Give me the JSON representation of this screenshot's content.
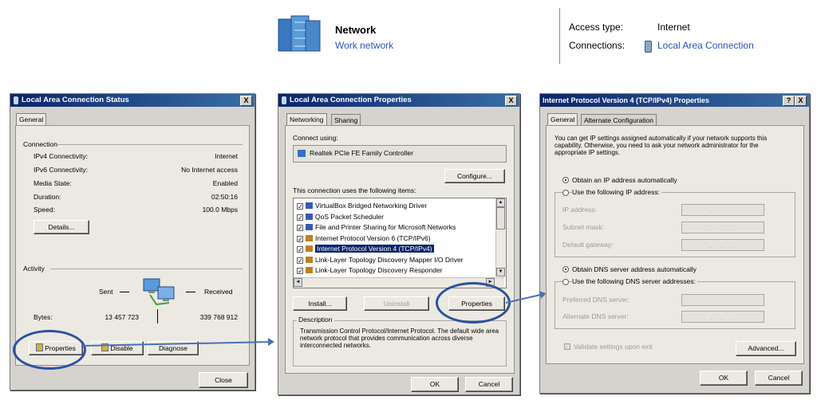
{
  "network_header": {
    "name": "Network",
    "type": "Work network",
    "access_label": "Access type:",
    "access_value": "Internet",
    "connections_label": "Connections:",
    "connections_value": "Local Area Connection"
  },
  "status_window": {
    "title": "Local Area Connection Status",
    "close_glyph": "X",
    "tab": "General",
    "connection_heading": "Connection",
    "rows": [
      {
        "label": "IPv4 Connectivity:",
        "value": "Internet"
      },
      {
        "label": "IPv6 Connectivity:",
        "value": "No Internet access"
      },
      {
        "label": "Media State:",
        "value": "Enabled"
      },
      {
        "label": "Duration:",
        "value": "02:50:16"
      },
      {
        "label": "Speed:",
        "value": "100.0 Mbps"
      }
    ],
    "details_button": "Details...",
    "activity_heading": "Activity",
    "sent_label": "Sent",
    "received_label": "Received",
    "bytes_label": "Bytes:",
    "bytes_sent": "13 457 723",
    "bytes_received": "339 768 912",
    "properties_button": "Properties",
    "disable_button": "Disable",
    "diagnose_button": "Diagnose",
    "close_button": "Close"
  },
  "properties_window": {
    "title": "Local Area Connection Properties",
    "close_glyph": "X",
    "tabs": [
      "Networking",
      "Sharing"
    ],
    "connect_using_label": "Connect using:",
    "adapter": "Realtek PCIe FE Family Controller",
    "configure_button": "Configure...",
    "items_label": "This connection uses the following items:",
    "items": [
      {
        "label": "VirtualBox Bridged Networking Driver",
        "checked": true,
        "icon_color": "#3a5ab0"
      },
      {
        "label": "QoS Packet Scheduler",
        "checked": true,
        "icon_color": "#3a5ab0"
      },
      {
        "label": "File and Printer Sharing for Microsoft Networks",
        "checked": true,
        "icon_color": "#3a5ab0"
      },
      {
        "label": "Internet Protocol Version 6 (TCP/IPv6)",
        "checked": true,
        "icon_color": "#c08020"
      },
      {
        "label": "Internet Protocol Version 4 (TCP/IPv4)",
        "checked": true,
        "icon_color": "#c08020",
        "selected": true
      },
      {
        "label": "Link-Layer Topology Discovery Mapper I/O Driver",
        "checked": true,
        "icon_color": "#c08020"
      },
      {
        "label": "Link-Layer Topology Discovery Responder",
        "checked": true,
        "icon_color": "#c08020"
      }
    ],
    "install_button": "Install...",
    "uninstall_button": "Uninstall",
    "properties_button": "Properties",
    "description_heading": "Description",
    "description_text": "Transmission Control Protocol/Internet Protocol. The default wide area network protocol that provides communication across diverse interconnected networks.",
    "ok_button": "OK",
    "cancel_button": "Cancel"
  },
  "ipv4_window": {
    "title": "Internet Protocol Version 4 (TCP/IPv4) Properties",
    "help_glyph": "?",
    "close_glyph": "X",
    "tabs": [
      "General",
      "Alternate Configuration"
    ],
    "intro": "You can get IP settings assigned automatically if your network supports this capability. Otherwise, you need to ask your network administrator for the appropriate IP settings.",
    "auto_ip": "Obtain an IP address automatically",
    "manual_ip": "Use the following IP address:",
    "ip_fields": [
      "IP address:",
      "Subnet mask:",
      "Default gateway:"
    ],
    "auto_dns": "Obtain DNS server address automatically",
    "manual_dns": "Use the following DNS server addresses:",
    "dns_fields": [
      "Preferred DNS server:",
      "Alternate DNS server:"
    ],
    "ip_placeholder": ".   .   .",
    "validate": "Validate settings upon exit",
    "advanced_button": "Advanced...",
    "ok_button": "OK",
    "cancel_button": "Cancel"
  },
  "colors": {
    "titlebar": "#0a246a",
    "annotation": "#2a52a0",
    "link": "#2a52c0"
  }
}
